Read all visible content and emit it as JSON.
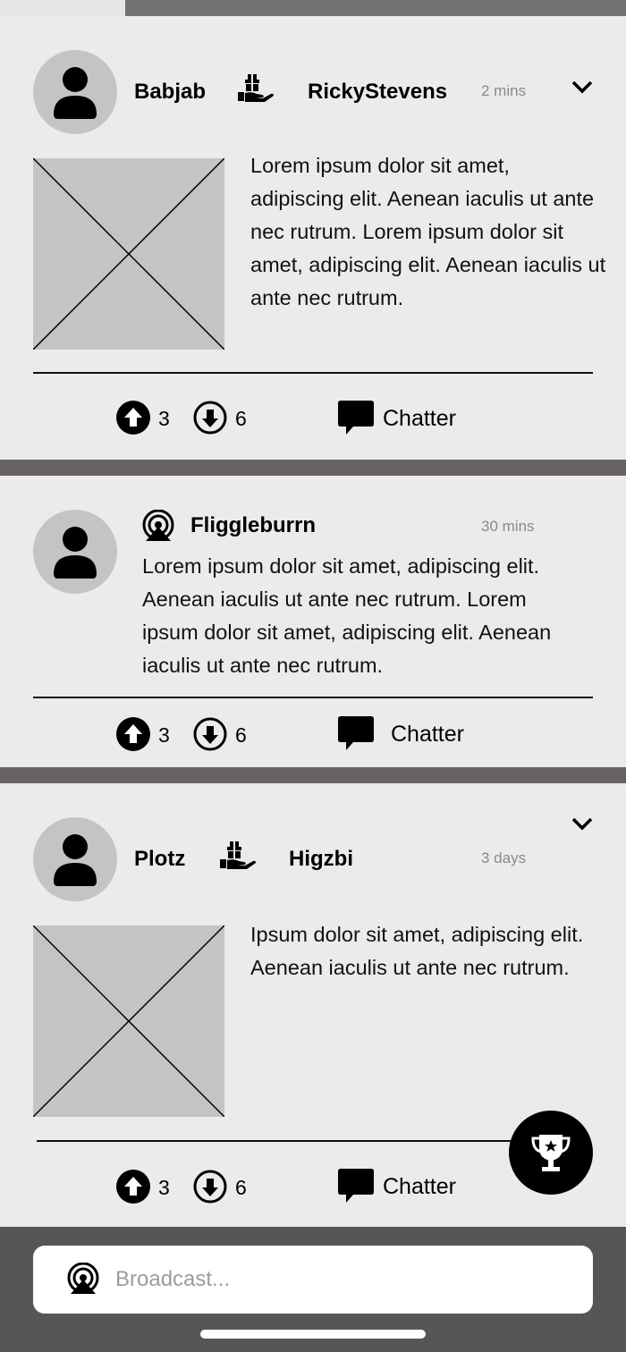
{
  "posts": [
    {
      "sender": "Babjab",
      "recipient": "RickyStevens",
      "time": "2 mins",
      "text": "Lorem ipsum dolor sit amet, adipiscing elit. Aenean iaculis ut ante nec rutrum. Lorem ipsum dolor sit amet, adipiscing elit. Aenean iaculis ut ante nec rutrum.",
      "upvotes": "3",
      "downvotes": "6",
      "chatter_label": "Chatter"
    },
    {
      "author": "Fliggleburrn",
      "time": "30 mins",
      "text": "Lorem ipsum dolor sit amet, adipiscing elit. Aenean iaculis ut ante nec rutrum. Lorem ipsum dolor sit amet, adipiscing elit. Aenean iaculis ut ante nec rutrum.",
      "upvotes": "3",
      "downvotes": "6",
      "chatter_label": "Chatter"
    },
    {
      "sender": "Plotz",
      "recipient": "Higzbi",
      "time": "3 days",
      "text": "Ipsum dolor sit amet, adipiscing elit. Aenean iaculis ut ante nec rutrum.",
      "upvotes": "3",
      "downvotes": "6",
      "chatter_label": "Chatter"
    }
  ],
  "broadcast": {
    "placeholder": "Broadcast..."
  },
  "icons": {
    "avatar": "user-avatar-icon",
    "gift": "gift-hand-icon",
    "broadcast": "broadcast-icon",
    "upvote": "arrow-up-circle-icon",
    "downvote": "arrow-down-circle-icon",
    "chatter": "chat-bubble-icon",
    "expand": "chevron-down-icon",
    "fab": "trophy-icon"
  },
  "colors": {
    "card_background": "#ebebeb",
    "separator": "#676262",
    "avatar_background": "#c4c4c4",
    "fab_background": "#000000"
  }
}
